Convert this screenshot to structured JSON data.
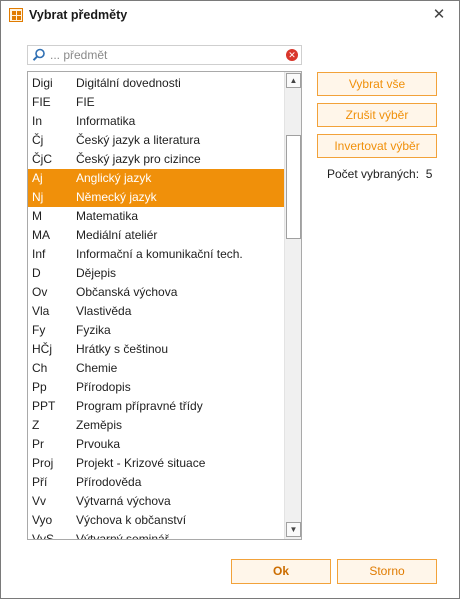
{
  "window": {
    "title": "Vybrat předměty",
    "close_glyph": "✕"
  },
  "search": {
    "value": "",
    "placeholder": "... předmět",
    "clear_glyph": "✕"
  },
  "subjects": [
    {
      "abbr": "Digi",
      "name": "Digitální dovednosti",
      "selected": false
    },
    {
      "abbr": "FIE",
      "name": "FIE",
      "selected": false
    },
    {
      "abbr": "In",
      "name": "Informatika",
      "selected": false
    },
    {
      "abbr": "Čj",
      "name": "Český jazyk a literatura",
      "selected": false
    },
    {
      "abbr": "ČjC",
      "name": "Český jazyk pro cizince",
      "selected": false
    },
    {
      "abbr": "Aj",
      "name": "Anglický jazyk",
      "selected": true
    },
    {
      "abbr": "Nj",
      "name": "Německý jazyk",
      "selected": true
    },
    {
      "abbr": "M",
      "name": "Matematika",
      "selected": false
    },
    {
      "abbr": "MA",
      "name": "Mediální ateliér",
      "selected": false
    },
    {
      "abbr": "Inf",
      "name": "Informační a komunikační tech.",
      "selected": false
    },
    {
      "abbr": "D",
      "name": "Dějepis",
      "selected": false
    },
    {
      "abbr": "Ov",
      "name": "Občanská výchova",
      "selected": false
    },
    {
      "abbr": "Vla",
      "name": "Vlastivěda",
      "selected": false
    },
    {
      "abbr": "Fy",
      "name": "Fyzika",
      "selected": false
    },
    {
      "abbr": "HČj",
      "name": "Hrátky s češtinou",
      "selected": false
    },
    {
      "abbr": "Ch",
      "name": "Chemie",
      "selected": false
    },
    {
      "abbr": "Pp",
      "name": "Přírodopis",
      "selected": false
    },
    {
      "abbr": "PPT",
      "name": "Program přípravné třídy",
      "selected": false
    },
    {
      "abbr": "Z",
      "name": "Zeměpis",
      "selected": false
    },
    {
      "abbr": "Pr",
      "name": "Prvouka",
      "selected": false
    },
    {
      "abbr": "Proj",
      "name": "Projekt - Krizové situace",
      "selected": false
    },
    {
      "abbr": "Pří",
      "name": "Přírodověda",
      "selected": false
    },
    {
      "abbr": "Vv",
      "name": "Výtvarná výchova",
      "selected": false
    },
    {
      "abbr": "Vyo",
      "name": "Výchova k občanství",
      "selected": false
    },
    {
      "abbr": "VvS",
      "name": "Výtvarný seminář",
      "selected": false
    }
  ],
  "scrollbar": {
    "up_glyph": "▲",
    "down_glyph": "▼"
  },
  "actions": {
    "select_all": "Vybrat vše",
    "clear_selection": "Zrušit výběr",
    "invert_selection": "Invertovat výběr"
  },
  "count": {
    "label": "Počet vybraných:",
    "value": "5"
  },
  "footer": {
    "ok": "Ok",
    "cancel": "Storno"
  },
  "colors": {
    "accent": "#f0900a",
    "accent_border": "#f2a23a",
    "accent_bg": "#fff6ea",
    "clear_red": "#d9362b"
  }
}
